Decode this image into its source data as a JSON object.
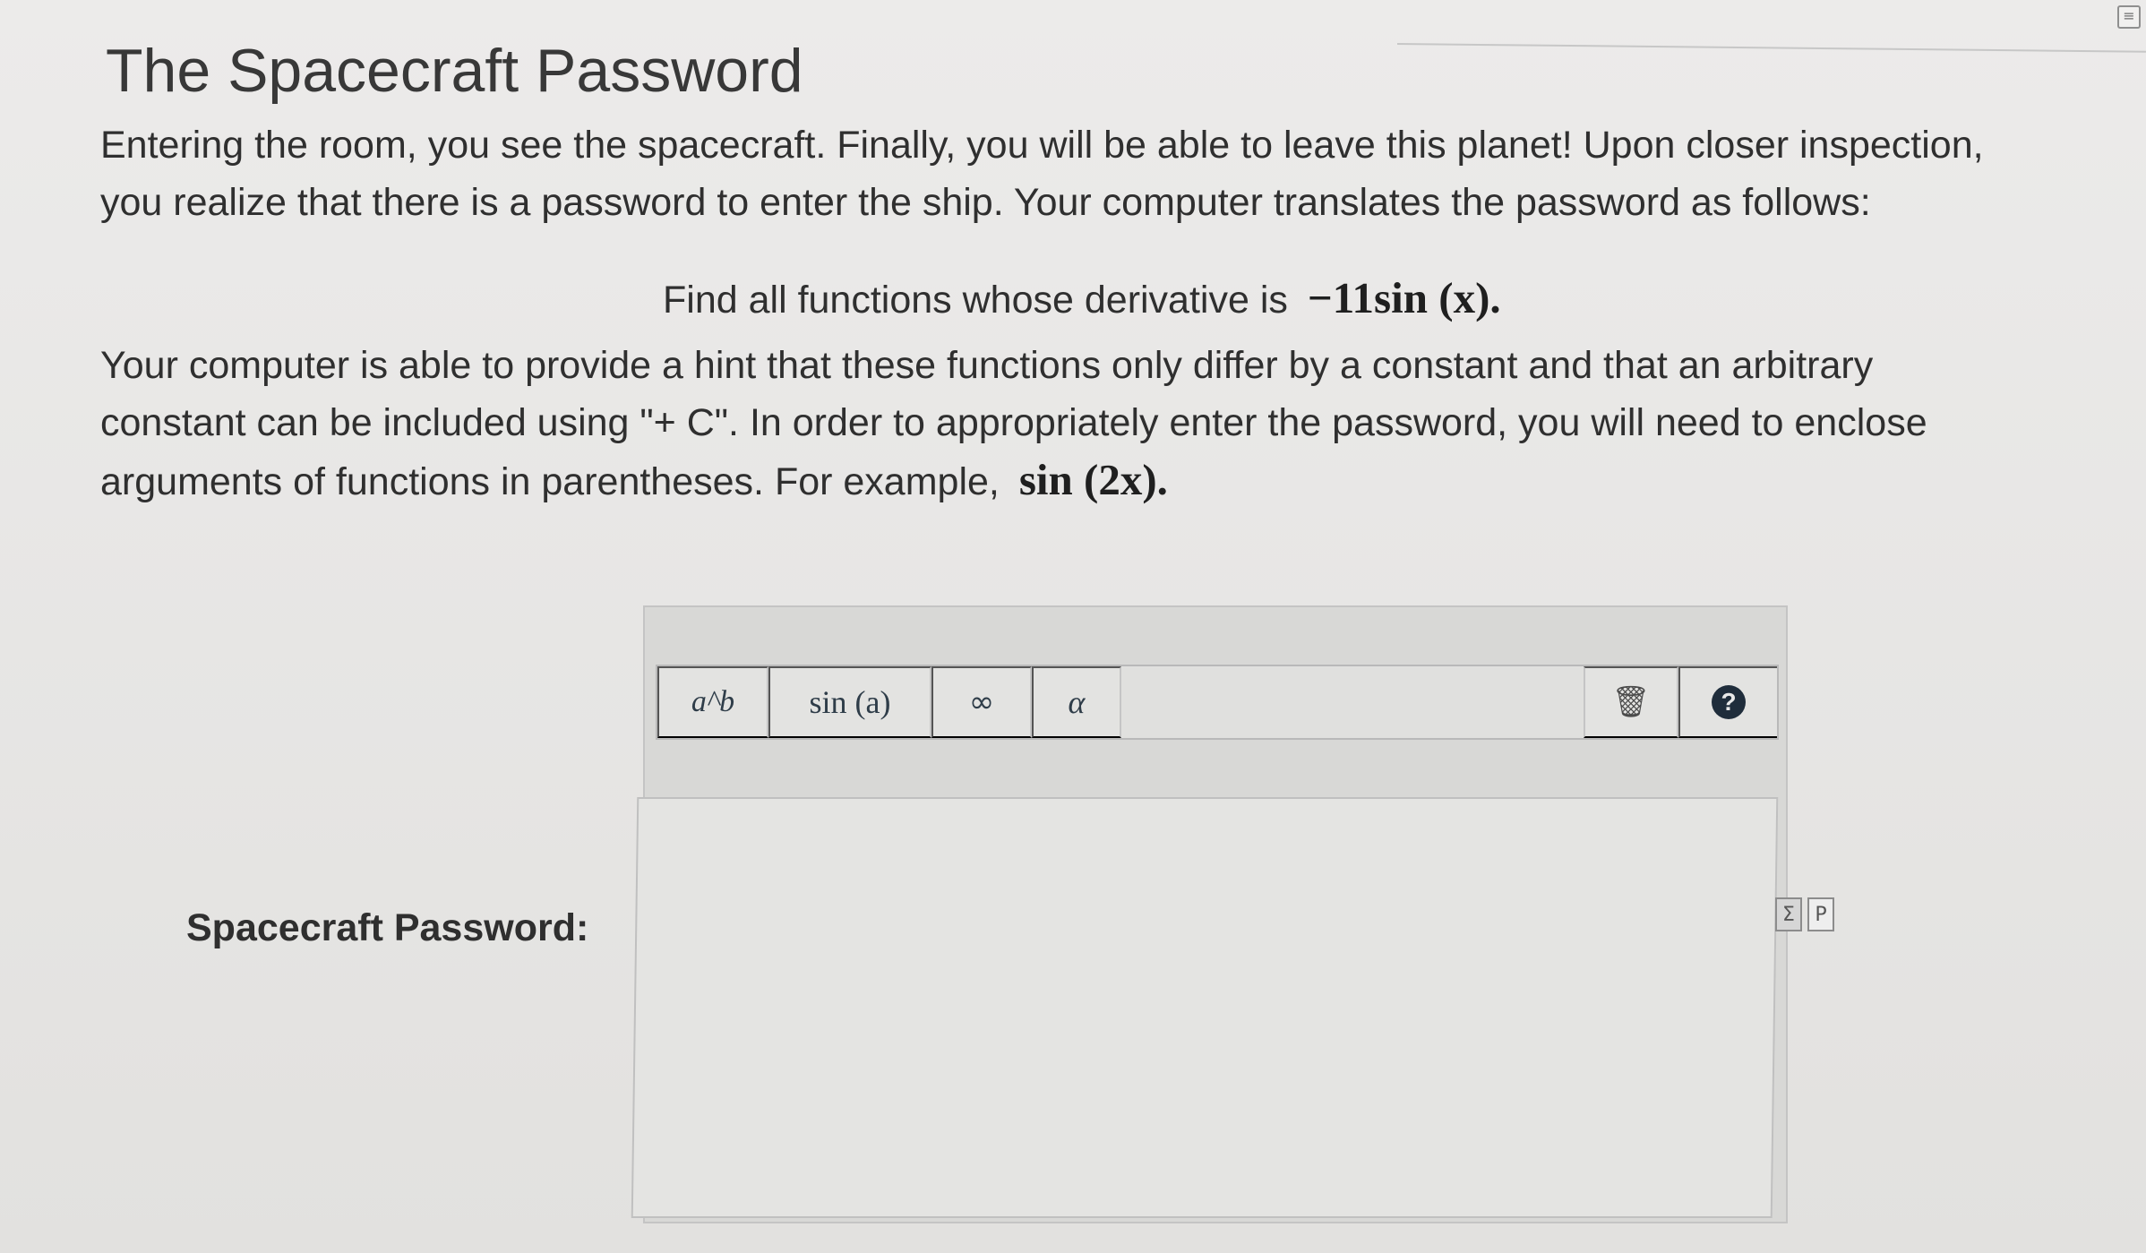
{
  "page": {
    "title": "The Spacecraft Password",
    "intro": "Entering the room, you see the spacecraft. Finally, you will be able to leave this planet! Upon closer inspection, you realize that there is a password to enter the ship. Your computer translates the password as follows:",
    "prompt_prefix": "Find all functions whose derivative is",
    "prompt_math": "−11sin (x).",
    "hint_before_example": "Your computer is able to provide a hint that these functions only differ by a constant and that an arbitrary constant can be included using \"+ C\". In order to appropriately enter the password, you will need to enclose arguments of functions in parentheses. For example, ",
    "hint_example": "sin (2x)."
  },
  "field": {
    "label": "Spacecraft Password:"
  },
  "toolbar": {
    "exponent_label": "a^b",
    "function_label": "sin (a)",
    "infinity_label": "∞",
    "greek_label": "α",
    "trash_label": "🗑",
    "help_label": "?"
  },
  "icons": {
    "corner": "panel-icon",
    "math_preview": "sigma-icon",
    "document": "document-icon"
  },
  "side_icons": {
    "sigma": "Σ",
    "doc": "P"
  },
  "corner_icon_label": "≡"
}
